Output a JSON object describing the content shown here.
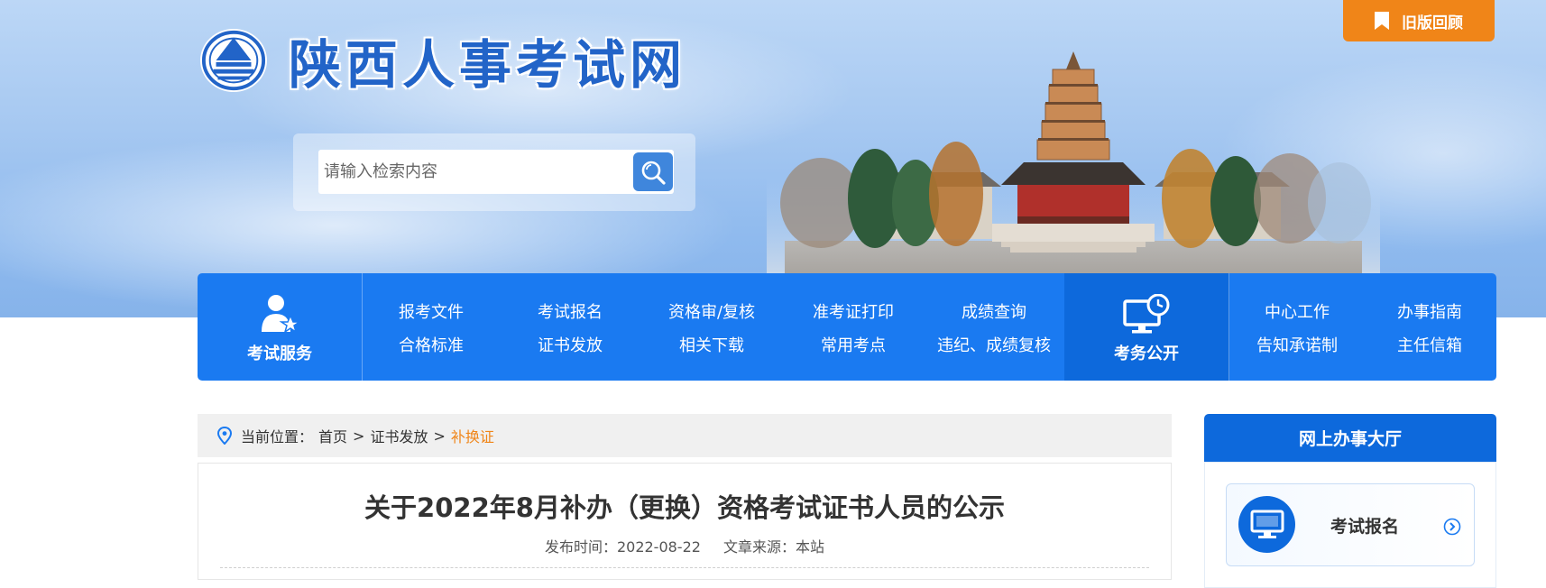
{
  "header": {
    "site_title": "陕西人事考试网",
    "old_version_label": "旧版回顾"
  },
  "search": {
    "placeholder": "请输入检索内容"
  },
  "nav": {
    "service_title": "考试服务",
    "service_links": [
      "报考文件",
      "考试报名",
      "资格审/复核",
      "准考证打印",
      "成绩查询",
      "合格标准",
      "证书发放",
      "相关下载",
      "常用考点",
      "违纪、成绩复核"
    ],
    "public_title": "考务公开",
    "public_links": [
      "中心工作",
      "办事指南",
      "告知承诺制",
      "主任信箱"
    ]
  },
  "breadcrumb": {
    "prefix": "当前位置：",
    "home": "首页",
    "parent": "证书发放",
    "current": "补换证",
    "separator": ">"
  },
  "article": {
    "title": "关于2022年8月补办（更换）资格考试证书人员的公示",
    "publish_label": "发布时间：",
    "publish_date": "2022-08-22",
    "source_label": "文章来源：",
    "source": "本站"
  },
  "sidebar": {
    "hall_title": "网上办事大厅",
    "items": [
      {
        "label": "考试报名",
        "icon": "monitor-icon"
      }
    ]
  },
  "colors": {
    "nav_blue": "#1a7af1",
    "nav_dark_blue": "#0d69dc",
    "accent_orange": "#f08518"
  }
}
